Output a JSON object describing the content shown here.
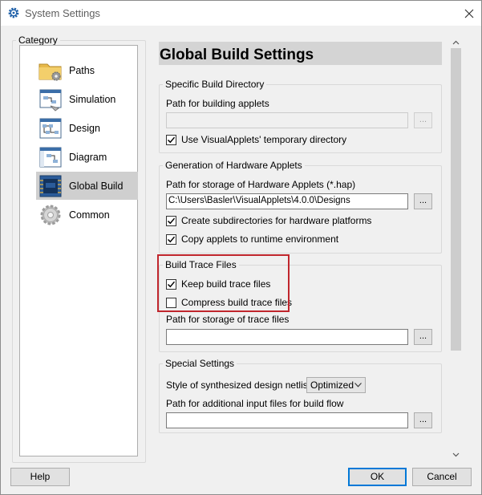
{
  "window": {
    "title": "System Settings",
    "icon": "gear-icon",
    "close_icon": "close-icon"
  },
  "category": {
    "legend": "Category",
    "items": [
      {
        "label": "Paths",
        "icon": "folder-gear-icon"
      },
      {
        "label": "Simulation",
        "icon": "simulation-icon"
      },
      {
        "label": "Design",
        "icon": "design-icon"
      },
      {
        "label": "Diagram",
        "icon": "diagram-icon"
      },
      {
        "label": "Global Build",
        "icon": "chip-icon",
        "selected": true
      },
      {
        "label": "Common",
        "icon": "gear-icon"
      }
    ]
  },
  "main": {
    "heading": "Global Build Settings",
    "specific_build_dir": {
      "legend": "Specific Build Directory",
      "path_label": "Path for building applets",
      "path_value": "",
      "browse_label": "...",
      "use_temp_label": "Use VisualApplets' temporary directory",
      "use_temp_checked": true
    },
    "generation": {
      "legend": "Generation of Hardware Applets",
      "path_label": "Path for storage of Hardware Applets (*.hap)",
      "path_value": "C:\\Users\\Basler\\VisualApplets\\4.0.0\\Designs",
      "browse_label": "...",
      "create_subdirs_label": "Create subdirectories for hardware platforms",
      "create_subdirs_checked": true,
      "copy_applets_label": "Copy applets to runtime environment",
      "copy_applets_checked": true
    },
    "build_trace": {
      "legend": "Build Trace Files",
      "keep_label": "Keep build trace files",
      "keep_checked": true,
      "compress_label": "Compress build trace files",
      "compress_checked": false,
      "path_label": "Path for storage of trace files",
      "path_value": "",
      "browse_label": "..."
    },
    "special": {
      "legend": "Special Settings",
      "style_label": "Style of synthesized design netlists",
      "style_value": "Optimized",
      "additional_label": "Path for additional input files for build flow",
      "additional_value": "",
      "browse_label": "..."
    }
  },
  "footer": {
    "help_label": "Help",
    "ok_label": "OK",
    "cancel_label": "Cancel"
  },
  "colors": {
    "highlight": "#c0262d",
    "selected_item": "#cfcfcf",
    "heading_bg": "#d4d4d4",
    "default_button_border": "#0078d7"
  }
}
